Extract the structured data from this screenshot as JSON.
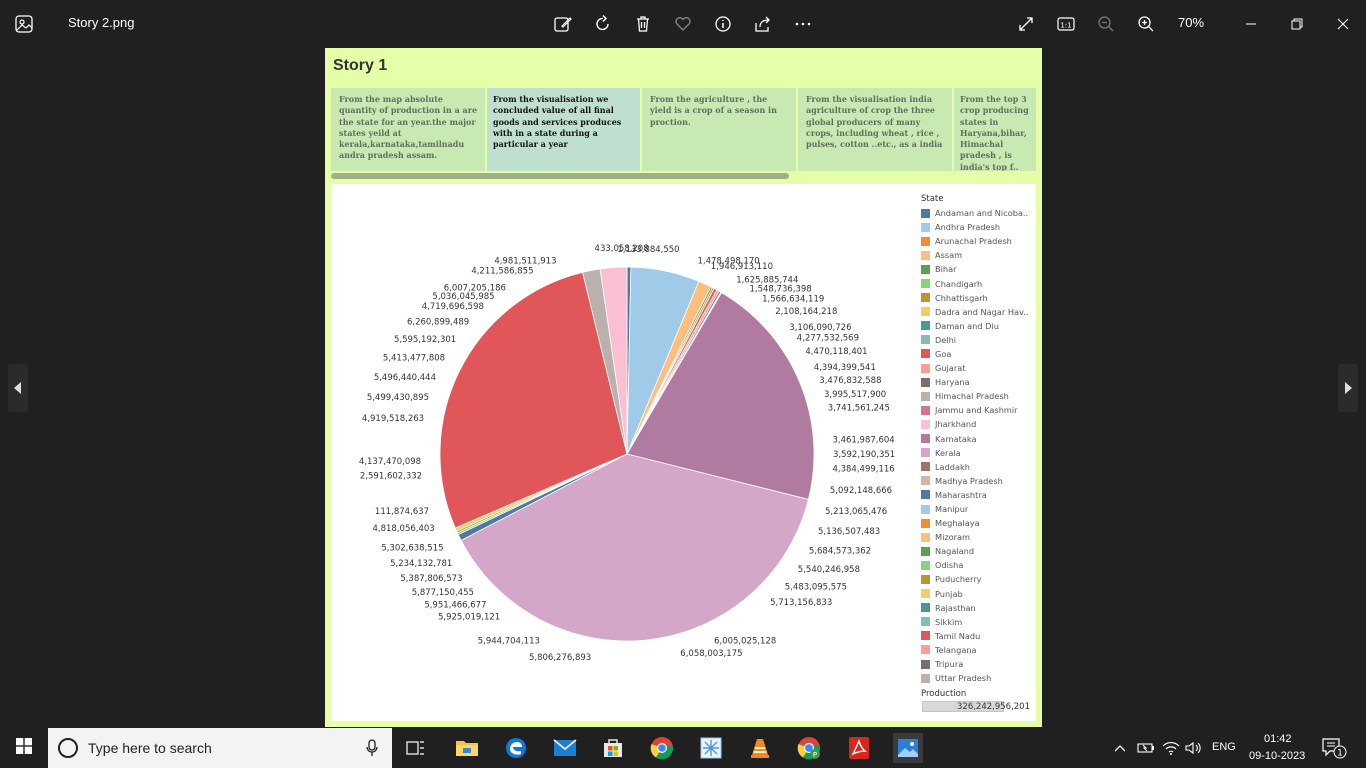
{
  "window": {
    "filename": "Story 2.png",
    "zoom": "70%",
    "icons": [
      "photos-app-icon",
      "edit-icon",
      "rotate-icon",
      "delete-icon",
      "favorite-icon",
      "info-icon",
      "share-icon",
      "more-icon",
      "fullscreen-icon",
      "actual-size-icon",
      "zoom-out-icon",
      "zoom-in-icon",
      "minimize-icon",
      "restore-icon",
      "close-icon"
    ]
  },
  "story": {
    "title": "Story 1",
    "tabs": [
      {
        "text": "From the map absolute quantity of production in a are the state for an year.the major states yeild at kerala,karnataka,tamilnadu andra pradesh assam."
      },
      {
        "text": "From the visualisation we concluded value of all final goods and services produces with in a state during a particular a year"
      },
      {
        "text": "From  the  agriculture , the yield is a crop of a season in proction."
      },
      {
        "text": "From the visualisation india agriculture of crop the three global producers of many crops, including wheat , rice , pulses, cotton ..etc., as a india"
      },
      {
        "text": "From  the top  3 crop producing states in Haryana,bihar, Himachal pradesh ,  is india's top f.."
      }
    ],
    "active_tab": 1
  },
  "chart_data": {
    "type": "pie",
    "legend_title": "State",
    "size_legend": {
      "title": "Production",
      "value": "326,242,956,201"
    },
    "states": [
      {
        "name": "Andaman and Nicoba..",
        "color": "#4e79a7"
      },
      {
        "name": "Andhra Pradesh",
        "color": "#a0cbe8"
      },
      {
        "name": "Arunachal Pradesh",
        "color": "#f28e2b"
      },
      {
        "name": "Assam",
        "color": "#ffbe7d"
      },
      {
        "name": "Bihar",
        "color": "#59a14f"
      },
      {
        "name": "Chandigarh",
        "color": "#8cd17d"
      },
      {
        "name": "Chhattisgarh",
        "color": "#b6992d"
      },
      {
        "name": "Dadra and Nagar Hav..",
        "color": "#f1ce63"
      },
      {
        "name": "Daman and Diu",
        "color": "#499894"
      },
      {
        "name": "Delhi",
        "color": "#86bcb6"
      },
      {
        "name": "Goa",
        "color": "#e15759"
      },
      {
        "name": "Gujarat",
        "color": "#ff9d9a"
      },
      {
        "name": "Haryana",
        "color": "#79706e"
      },
      {
        "name": "Himachal Pradesh",
        "color": "#bab0ac"
      },
      {
        "name": "Jammu and Kashmir",
        "color": "#d37295"
      },
      {
        "name": "Jharkhand",
        "color": "#fabfd2"
      },
      {
        "name": "Karnataka",
        "color": "#b07aa1"
      },
      {
        "name": "Kerala",
        "color": "#d4a6c8"
      },
      {
        "name": "Laddakh",
        "color": "#9d7660"
      },
      {
        "name": "Madhya Pradesh",
        "color": "#d7b5a6"
      },
      {
        "name": "Maharashtra",
        "color": "#4e79a7"
      },
      {
        "name": "Manipur",
        "color": "#a0cbe8"
      },
      {
        "name": "Meghalaya",
        "color": "#f28e2b"
      },
      {
        "name": "Mizoram",
        "color": "#ffbe7d"
      },
      {
        "name": "Nagaland",
        "color": "#59a14f"
      },
      {
        "name": "Odisha",
        "color": "#8cd17d"
      },
      {
        "name": "Puducherry",
        "color": "#b6992d"
      },
      {
        "name": "Punjab",
        "color": "#f1ce63"
      },
      {
        "name": "Rajasthan",
        "color": "#499894"
      },
      {
        "name": "Sikkim",
        "color": "#86bcb6"
      },
      {
        "name": "Tamil Nadu",
        "color": "#e15759"
      },
      {
        "name": "Telangana",
        "color": "#ff9d9a"
      },
      {
        "name": "Tripura",
        "color": "#79706e"
      },
      {
        "name": "Uttar Pradesh",
        "color": "#bab0ac"
      }
    ],
    "slices": [
      {
        "state": "Andaman and Nicoba..",
        "value": 1.2,
        "color": "#4e79a7"
      },
      {
        "state": "Andhra Pradesh",
        "value": 21.5,
        "color": "#a0cbe8"
      },
      {
        "state": "Assam",
        "value": 4.0,
        "color": "#ffbe7d"
      },
      {
        "state": "Bihar",
        "value": 0.6,
        "color": "#59a14f"
      },
      {
        "state": "Chhattisgarh",
        "value": 0.6,
        "color": "#b6992d"
      },
      {
        "state": "Goa",
        "value": 0.9,
        "color": "#e15759"
      },
      {
        "state": "Gujarat",
        "value": 0.8,
        "color": "#ff9d9a"
      },
      {
        "state": "Haryana",
        "value": 0.6,
        "color": "#79706e"
      },
      {
        "state": "Jammu and Kashmir",
        "value": 0.3,
        "color": "#d37295"
      },
      {
        "state": "Karnataka",
        "value": 74.0,
        "color": "#b07aa1"
      },
      {
        "state": "Kerala",
        "value": 139.0,
        "color": "#d4a6c8"
      },
      {
        "state": "Maharashtra",
        "value": 2.0,
        "color": "#4e79a7"
      },
      {
        "state": "Odisha",
        "value": 0.6,
        "color": "#8cd17d"
      },
      {
        "state": "Puducherry",
        "value": 0.6,
        "color": "#b6992d"
      },
      {
        "state": "Punjab",
        "value": 1.0,
        "color": "#f1ce63"
      },
      {
        "state": "Tamil Nadu",
        "value": 100.0,
        "color": "#e15759"
      },
      {
        "state": "Uttar Pradesh",
        "value": 5.5,
        "color": "#bab0ac"
      },
      {
        "state": "Jharkhand",
        "value": 8.3,
        "color": "#fabfd2"
      }
    ],
    "labels": [
      {
        "text": "433,058,208",
        "angle": -1.5
      },
      {
        "text": "1,133,884,550",
        "angle": 6
      },
      {
        "text": "1,478,498,170",
        "angle": 20
      },
      {
        "text": "1,946,913,110",
        "angle": 24
      },
      {
        "text": "1,625,885,744",
        "angle": 32
      },
      {
        "text": "1,548,736,398",
        "angle": 36.5
      },
      {
        "text": "1,566,634,119",
        "angle": 41
      },
      {
        "text": "2,108,164,218",
        "angle": 46
      },
      {
        "text": "3,106,090,726",
        "angle": 52
      },
      {
        "text": "4,277,532,569",
        "angle": 55.5
      },
      {
        "text": "4,470,118,401",
        "angle": 60
      },
      {
        "text": "4,394,399,541",
        "angle": 65
      },
      {
        "text": "3,476,832,588",
        "angle": 69
      },
      {
        "text": "3,995,517,900",
        "angle": 73
      },
      {
        "text": "3,741,561,245",
        "angle": 77
      },
      {
        "text": "3,461,987,604",
        "angle": 86
      },
      {
        "text": "3,592,190,351",
        "angle": 90
      },
      {
        "text": "4,384,499,116",
        "angle": 94
      },
      {
        "text": "5,092,148,666",
        "angle": 100
      },
      {
        "text": "5,213,065,476",
        "angle": 106
      },
      {
        "text": "5,136,507,483",
        "angle": 112
      },
      {
        "text": "5,684,573,362",
        "angle": 118
      },
      {
        "text": "5,540,246,958",
        "angle": 124
      },
      {
        "text": "5,483,095,575",
        "angle": 130
      },
      {
        "text": "5,713,156,833",
        "angle": 136
      },
      {
        "text": "6,005,025,128",
        "angle": 155
      },
      {
        "text": "6,058,003,175",
        "angle": 165
      },
      {
        "text": "5,806,276,893",
        "angle": 190
      },
      {
        "text": "5,944,704,113",
        "angle": 205
      },
      {
        "text": "5,925,019,121",
        "angle": 218
      },
      {
        "text": "5,951,466,677",
        "angle": 223
      },
      {
        "text": "5,877,150,455",
        "angle": 228
      },
      {
        "text": "5,387,806,573",
        "angle": 233
      },
      {
        "text": "5,234,132,781",
        "angle": 238
      },
      {
        "text": "5,302,638,515",
        "angle": 243
      },
      {
        "text": "4,818,056,403",
        "angle": 249
      },
      {
        "text": "111,874,637",
        "angle": 254
      },
      {
        "text": "2,591,602,332",
        "angle": 264
      },
      {
        "text": "4,137,470,098",
        "angle": 268
      },
      {
        "text": "4,919,518,263",
        "angle": 280
      },
      {
        "text": "5,499,430,895",
        "angle": 286
      },
      {
        "text": "5,496,440,444",
        "angle": 292
      },
      {
        "text": "5,413,477,808",
        "angle": 298
      },
      {
        "text": "5,595,192,301",
        "angle": 304
      },
      {
        "text": "6,260,899,489",
        "angle": 310
      },
      {
        "text": "4,719,696,598",
        "angle": 316
      },
      {
        "text": "5,036,045,985",
        "angle": 320
      },
      {
        "text": "6,007,205,186",
        "angle": 324
      },
      {
        "text": "4,211,586,855",
        "angle": 333
      },
      {
        "text": "4,981,511,913",
        "angle": 340
      }
    ]
  },
  "taskbar": {
    "search_placeholder": "Type here to search",
    "language": "ENG",
    "time": "01:42",
    "date": "09-10-2023",
    "notification_count": "1"
  }
}
